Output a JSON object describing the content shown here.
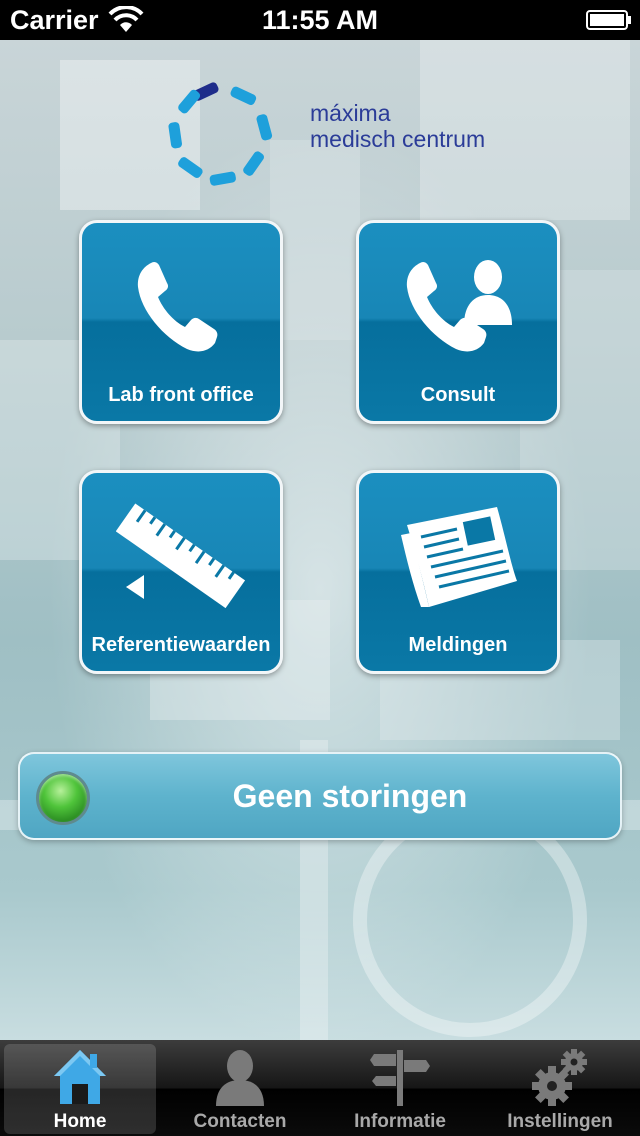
{
  "status_bar": {
    "carrier": "Carrier",
    "time": "11:55 AM"
  },
  "logo": {
    "line1": "máxima",
    "line2": "medisch centrum"
  },
  "tiles": [
    {
      "label": "Lab front office",
      "icon": "phone-icon"
    },
    {
      "label": "Consult",
      "icon": "phone-contact-icon"
    },
    {
      "label": "Referentiewaarden",
      "icon": "ruler-icon"
    },
    {
      "label": "Meldingen",
      "icon": "newspaper-icon"
    }
  ],
  "status_panel": {
    "text": "Geen storingen",
    "indicator_color": "#4fc43a"
  },
  "tabbar": {
    "tabs": [
      {
        "label": "Home",
        "icon": "home-icon",
        "active": true
      },
      {
        "label": "Contacten",
        "icon": "person-icon"
      },
      {
        "label": "Informatie",
        "icon": "signpost-icon"
      },
      {
        "label": "Instellingen",
        "icon": "gears-icon"
      }
    ]
  },
  "colors": {
    "tile": "#0a78a6",
    "brand_text": "#2b3c98",
    "logo_light": "#1ea0db",
    "logo_dark": "#1e2d8a"
  }
}
